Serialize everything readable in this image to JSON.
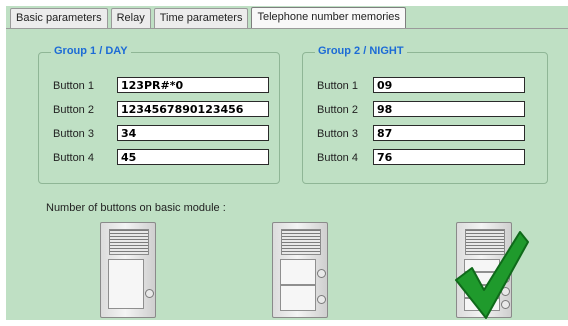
{
  "tabs": [
    {
      "label": "Basic parameters",
      "active": false
    },
    {
      "label": "Relay",
      "active": false
    },
    {
      "label": "Time parameters",
      "active": false
    },
    {
      "label": "Telephone number memories",
      "active": true
    }
  ],
  "group1": {
    "title": "Group 1 / DAY",
    "rows": [
      {
        "label": "Button 1",
        "value": "123PR#*0"
      },
      {
        "label": "Button 2",
        "value": "1234567890123456"
      },
      {
        "label": "Button 3",
        "value": "34"
      },
      {
        "label": "Button 4",
        "value": "45"
      }
    ]
  },
  "group2": {
    "title": "Group 2 / NIGHT",
    "rows": [
      {
        "label": "Button 1",
        "value": "09"
      },
      {
        "label": "Button 2",
        "value": "98"
      },
      {
        "label": "Button 3",
        "value": "87"
      },
      {
        "label": "Button 4",
        "value": "76"
      }
    ]
  },
  "modules": {
    "label": "Number of buttons on basic module :",
    "options": [
      {
        "buttons": 1,
        "selected": false
      },
      {
        "buttons": 2,
        "selected": false
      },
      {
        "buttons": 4,
        "selected": true
      }
    ]
  },
  "colors": {
    "panel": "#bfe0c4",
    "group_title": "#1c6bd6",
    "check": "#1f9a2c"
  }
}
